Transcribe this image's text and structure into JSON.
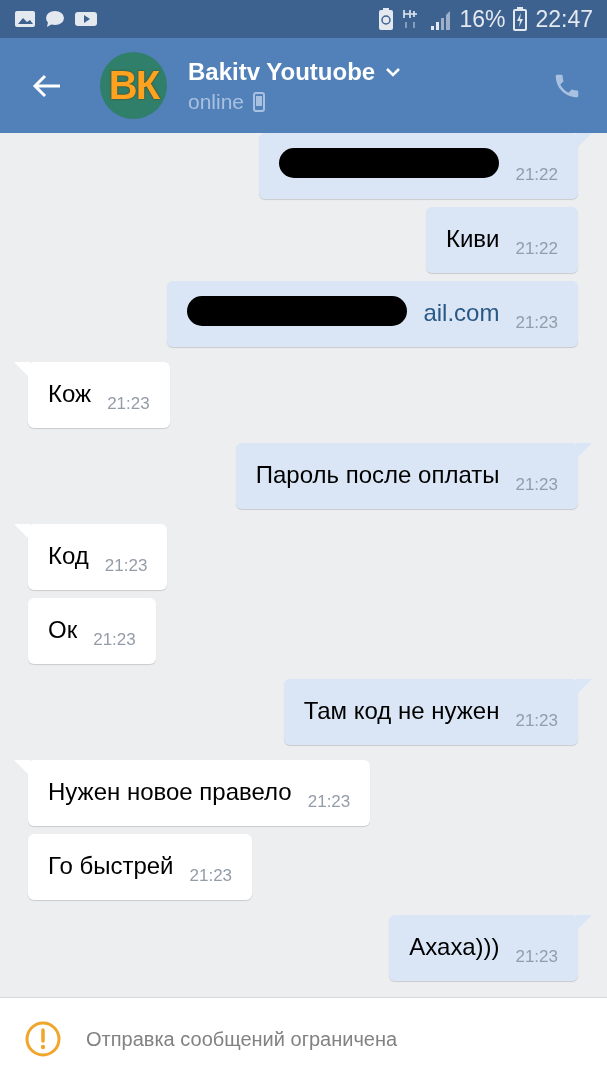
{
  "status_bar": {
    "battery": "16%",
    "time": "22:47"
  },
  "header": {
    "contact_name": "Bakitv Youtuobe",
    "presence": "online",
    "avatar_text": "ВК"
  },
  "messages": [
    {
      "kind": "outgoing",
      "tail": true,
      "redacted": true,
      "time": "21:22"
    },
    {
      "kind": "outgoing",
      "tail": false,
      "text": "Киви",
      "time": "21:22"
    },
    {
      "kind": "outgoing",
      "tail": false,
      "redacted": true,
      "text": "ail.com",
      "link": true,
      "time": "21:23"
    },
    {
      "kind": "incoming",
      "tail": true,
      "text": "Кож",
      "time": "21:23"
    },
    {
      "kind": "outgoing",
      "tail": true,
      "text": "Пароль после оплаты",
      "time": "21:23"
    },
    {
      "kind": "incoming",
      "tail": true,
      "text": "Код",
      "time": "21:23"
    },
    {
      "kind": "incoming",
      "tail": false,
      "text": "Ок",
      "time": "21:23"
    },
    {
      "kind": "outgoing",
      "tail": true,
      "text": "Там код не нужен",
      "time": "21:23"
    },
    {
      "kind": "incoming",
      "tail": true,
      "text": "Нужен новое правело",
      "time": "21:23"
    },
    {
      "kind": "incoming",
      "tail": false,
      "text": "Го быстрей",
      "time": "21:23"
    },
    {
      "kind": "outgoing",
      "tail": true,
      "text": "Ахаха)))",
      "time": "21:23"
    }
  ],
  "notice": {
    "text": "Отправка сообщений ограничена"
  }
}
